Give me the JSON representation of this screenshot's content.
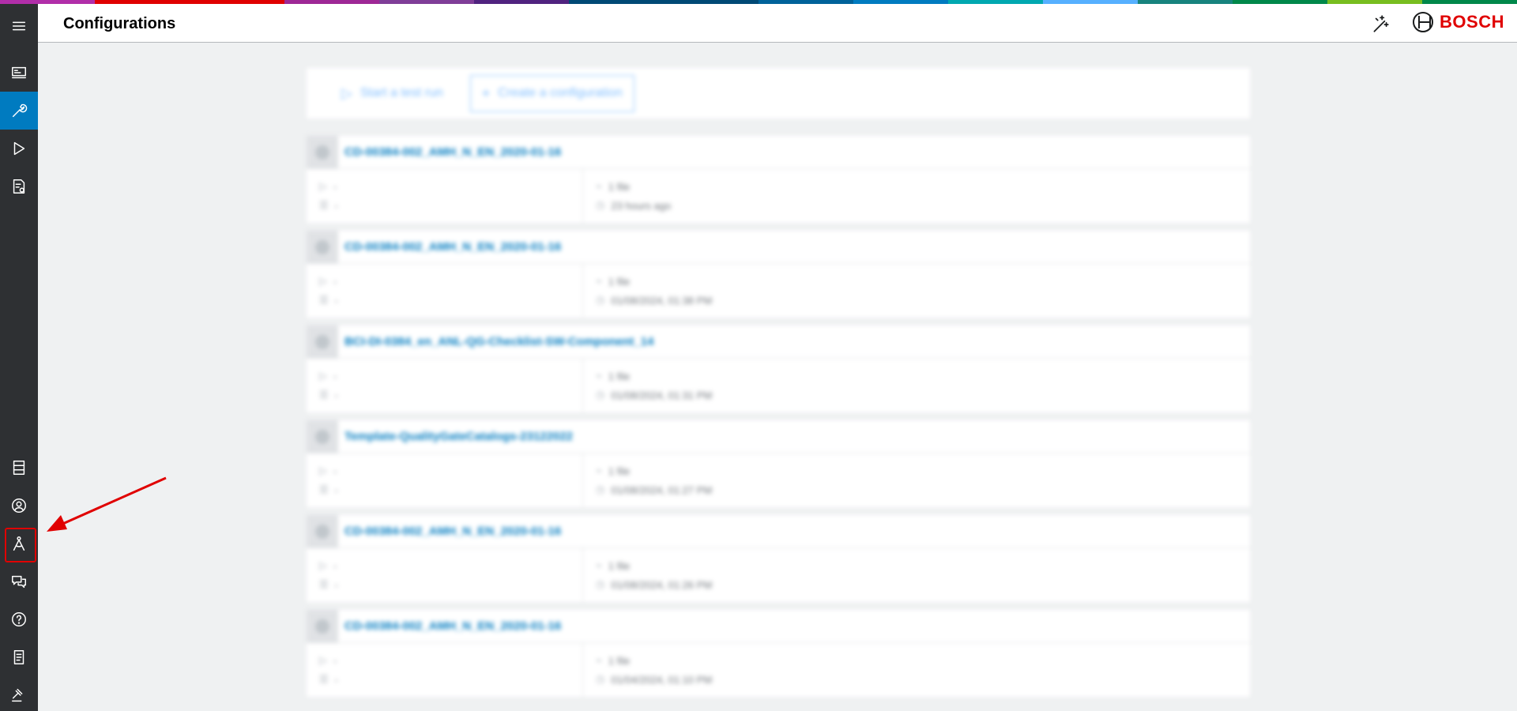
{
  "colors": {
    "sidebar_bg": "#2e3033",
    "active": "#007bc0",
    "brand_red": "#e00000",
    "link_blue": "#007bc0",
    "supergraphic": [
      "#9e2896",
      "#c535bc",
      "#e00000",
      "#7f3e98",
      "#50237f",
      "#18837e",
      "#007bc0",
      "#004975",
      "#00a8b0",
      "#56b0ff",
      "#00884a",
      "#78be20",
      "#00629a",
      "#b12ea9"
    ]
  },
  "header": {
    "title": "Configurations",
    "brand": "BOSCH"
  },
  "sidebar": {
    "items": [
      {
        "name": "dashboard",
        "icon": "dashboard-icon"
      },
      {
        "name": "configurations",
        "icon": "wrench-icon",
        "active": true
      },
      {
        "name": "test-runs",
        "icon": "play-icon"
      },
      {
        "name": "reports",
        "icon": "report-icon"
      },
      {
        "name": "storage",
        "icon": "server-icon"
      },
      {
        "name": "user",
        "icon": "user-icon"
      },
      {
        "name": "admin",
        "icon": "compass-user-icon",
        "highlighted": true
      },
      {
        "name": "feedback",
        "icon": "chat-icon"
      },
      {
        "name": "help",
        "icon": "help-icon"
      },
      {
        "name": "documentation",
        "icon": "document-icon"
      },
      {
        "name": "legal",
        "icon": "gavel-icon"
      }
    ]
  },
  "toolbar": {
    "start_test_run": "Start a test run",
    "create_configuration": "Create a configuration"
  },
  "configurations": [
    {
      "title": "CD-00384-002_AMH_N_EN_2020-01-16",
      "runs": "-",
      "note": "-",
      "files": "1 file",
      "time": "23 hours ago"
    },
    {
      "title": "CD-00384-002_AMH_N_EN_2020-01-16",
      "runs": "-",
      "note": "-",
      "files": "1 file",
      "time": "01/08/2024, 01:38 PM"
    },
    {
      "title": "BCI-DI-0384_en_ANL-QG-Checklist-SW-Component_14",
      "runs": "-",
      "note": "-",
      "files": "1 file",
      "time": "01/08/2024, 01:31 PM"
    },
    {
      "title": "Template-QualityGateCatalogs-23122022",
      "runs": "-",
      "note": "-",
      "files": "1 file",
      "time": "01/08/2024, 01:27 PM"
    },
    {
      "title": "CD-00384-002_AMH_N_EN_2020-01-16",
      "runs": "-",
      "note": "-",
      "files": "1 file",
      "time": "01/08/2024, 01:26 PM"
    },
    {
      "title": "CD-00384-002_AMH_N_EN_2020-01-16",
      "runs": "-",
      "note": "-",
      "files": "1 file",
      "time": "01/04/2024, 01:10 PM"
    }
  ]
}
